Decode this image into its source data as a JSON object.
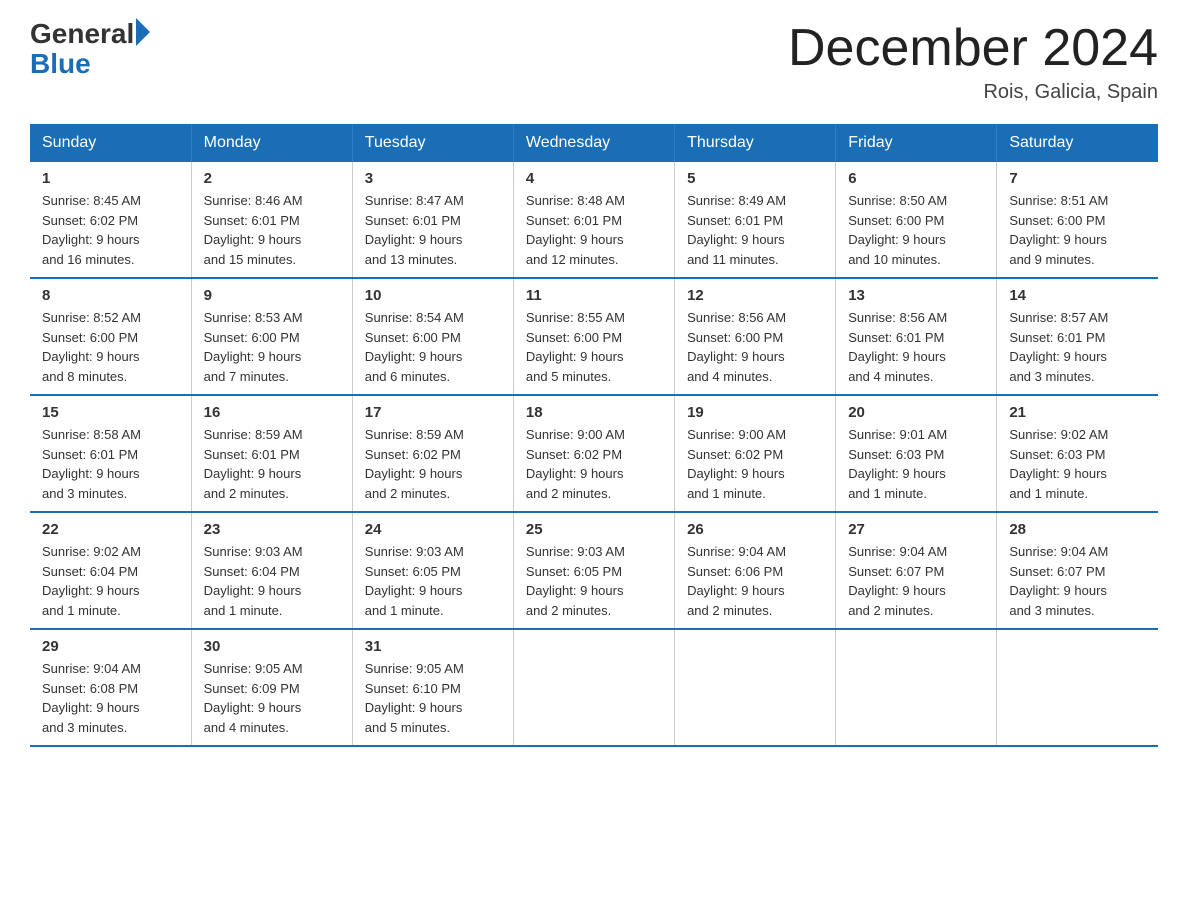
{
  "header": {
    "logo_general": "General",
    "logo_blue": "Blue",
    "title": "December 2024",
    "location": "Rois, Galicia, Spain"
  },
  "days_of_week": [
    "Sunday",
    "Monday",
    "Tuesday",
    "Wednesday",
    "Thursday",
    "Friday",
    "Saturday"
  ],
  "weeks": [
    [
      {
        "day": "1",
        "sunrise": "8:45 AM",
        "sunset": "6:02 PM",
        "daylight": "9 hours and 16 minutes."
      },
      {
        "day": "2",
        "sunrise": "8:46 AM",
        "sunset": "6:01 PM",
        "daylight": "9 hours and 15 minutes."
      },
      {
        "day": "3",
        "sunrise": "8:47 AM",
        "sunset": "6:01 PM",
        "daylight": "9 hours and 13 minutes."
      },
      {
        "day": "4",
        "sunrise": "8:48 AM",
        "sunset": "6:01 PM",
        "daylight": "9 hours and 12 minutes."
      },
      {
        "day": "5",
        "sunrise": "8:49 AM",
        "sunset": "6:01 PM",
        "daylight": "9 hours and 11 minutes."
      },
      {
        "day": "6",
        "sunrise": "8:50 AM",
        "sunset": "6:00 PM",
        "daylight": "9 hours and 10 minutes."
      },
      {
        "day": "7",
        "sunrise": "8:51 AM",
        "sunset": "6:00 PM",
        "daylight": "9 hours and 9 minutes."
      }
    ],
    [
      {
        "day": "8",
        "sunrise": "8:52 AM",
        "sunset": "6:00 PM",
        "daylight": "9 hours and 8 minutes."
      },
      {
        "day": "9",
        "sunrise": "8:53 AM",
        "sunset": "6:00 PM",
        "daylight": "9 hours and 7 minutes."
      },
      {
        "day": "10",
        "sunrise": "8:54 AM",
        "sunset": "6:00 PM",
        "daylight": "9 hours and 6 minutes."
      },
      {
        "day": "11",
        "sunrise": "8:55 AM",
        "sunset": "6:00 PM",
        "daylight": "9 hours and 5 minutes."
      },
      {
        "day": "12",
        "sunrise": "8:56 AM",
        "sunset": "6:00 PM",
        "daylight": "9 hours and 4 minutes."
      },
      {
        "day": "13",
        "sunrise": "8:56 AM",
        "sunset": "6:01 PM",
        "daylight": "9 hours and 4 minutes."
      },
      {
        "day": "14",
        "sunrise": "8:57 AM",
        "sunset": "6:01 PM",
        "daylight": "9 hours and 3 minutes."
      }
    ],
    [
      {
        "day": "15",
        "sunrise": "8:58 AM",
        "sunset": "6:01 PM",
        "daylight": "9 hours and 3 minutes."
      },
      {
        "day": "16",
        "sunrise": "8:59 AM",
        "sunset": "6:01 PM",
        "daylight": "9 hours and 2 minutes."
      },
      {
        "day": "17",
        "sunrise": "8:59 AM",
        "sunset": "6:02 PM",
        "daylight": "9 hours and 2 minutes."
      },
      {
        "day": "18",
        "sunrise": "9:00 AM",
        "sunset": "6:02 PM",
        "daylight": "9 hours and 2 minutes."
      },
      {
        "day": "19",
        "sunrise": "9:00 AM",
        "sunset": "6:02 PM",
        "daylight": "9 hours and 1 minute."
      },
      {
        "day": "20",
        "sunrise": "9:01 AM",
        "sunset": "6:03 PM",
        "daylight": "9 hours and 1 minute."
      },
      {
        "day": "21",
        "sunrise": "9:02 AM",
        "sunset": "6:03 PM",
        "daylight": "9 hours and 1 minute."
      }
    ],
    [
      {
        "day": "22",
        "sunrise": "9:02 AM",
        "sunset": "6:04 PM",
        "daylight": "9 hours and 1 minute."
      },
      {
        "day": "23",
        "sunrise": "9:03 AM",
        "sunset": "6:04 PM",
        "daylight": "9 hours and 1 minute."
      },
      {
        "day": "24",
        "sunrise": "9:03 AM",
        "sunset": "6:05 PM",
        "daylight": "9 hours and 1 minute."
      },
      {
        "day": "25",
        "sunrise": "9:03 AM",
        "sunset": "6:05 PM",
        "daylight": "9 hours and 2 minutes."
      },
      {
        "day": "26",
        "sunrise": "9:04 AM",
        "sunset": "6:06 PM",
        "daylight": "9 hours and 2 minutes."
      },
      {
        "day": "27",
        "sunrise": "9:04 AM",
        "sunset": "6:07 PM",
        "daylight": "9 hours and 2 minutes."
      },
      {
        "day": "28",
        "sunrise": "9:04 AM",
        "sunset": "6:07 PM",
        "daylight": "9 hours and 3 minutes."
      }
    ],
    [
      {
        "day": "29",
        "sunrise": "9:04 AM",
        "sunset": "6:08 PM",
        "daylight": "9 hours and 3 minutes."
      },
      {
        "day": "30",
        "sunrise": "9:05 AM",
        "sunset": "6:09 PM",
        "daylight": "9 hours and 4 minutes."
      },
      {
        "day": "31",
        "sunrise": "9:05 AM",
        "sunset": "6:10 PM",
        "daylight": "9 hours and 5 minutes."
      },
      null,
      null,
      null,
      null
    ]
  ],
  "labels": {
    "sunrise": "Sunrise:",
    "sunset": "Sunset:",
    "daylight": "Daylight:"
  }
}
